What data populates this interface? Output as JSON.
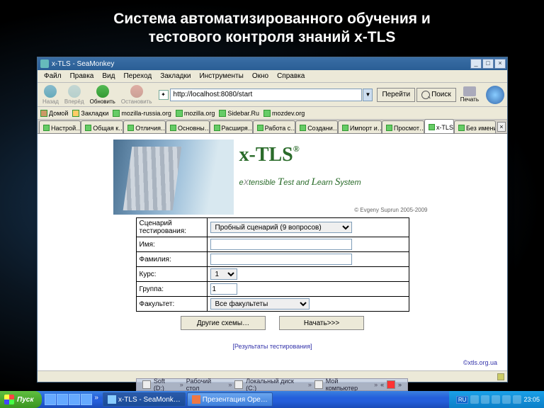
{
  "slide": {
    "title_l1": "Система автоматизированного обучения и",
    "title_l2": "тестового контроля знаний x-TLS"
  },
  "window": {
    "title": "x-TLS - SeaMonkey"
  },
  "menu": {
    "file": "Файл",
    "edit": "Правка",
    "view": "Вид",
    "go": "Переход",
    "bookmarks": "Закладки",
    "tools": "Инструменты",
    "window": "Окно",
    "help": "Справка"
  },
  "nav": {
    "back": "Назад",
    "forward": "Вперёд",
    "reload": "Обновить",
    "stop": "Остановить",
    "url": "http://localhost:8080/start",
    "go": "Перейти",
    "search": "Поиск",
    "print": "Печать"
  },
  "bookmarks": {
    "home": "Домой",
    "folder": "Закладки",
    "items": [
      "mozilla-russia.org",
      "mozilla.org",
      "Sidebar.Ru",
      "mozdev.org"
    ]
  },
  "tabs": {
    "items": [
      "Настрой…",
      "Общая к…",
      "Отличия…",
      "Основны…",
      "Расширя…",
      "Работа с…",
      "Создани…",
      "Импорт и…",
      "Просмот…",
      "x-TLS",
      "Без имени"
    ],
    "active_index": 9
  },
  "hero": {
    "logo": "x-TLS",
    "reg": "®",
    "tagline_pre": "e",
    "tagline_x": "X",
    "tagline_mid1": "tensible ",
    "tagline_t": "T",
    "tagline_mid2": "est and ",
    "tagline_l": "L",
    "tagline_mid3": "earn ",
    "tagline_s": "S",
    "tagline_end": "ystem",
    "copyright": "© Evgeny Suprun 2005-2009"
  },
  "form": {
    "scenario_label": "Сценарий тестирования:",
    "scenario_value": "Пробный сценарий (9 вопросов)",
    "name_label": "Имя:",
    "name_value": "",
    "surname_label": "Фамилия:",
    "surname_value": "",
    "course_label": "Курс:",
    "course_value": "1",
    "group_label": "Группа:",
    "group_value": "1",
    "faculty_label": "Факультет:",
    "faculty_value": "Все факультеты",
    "btn_other": "Другие схемы…",
    "btn_start": "Начать>>>"
  },
  "links": {
    "results": "[Результаты тестирования]",
    "site": "©xtls.org.ua"
  },
  "statusbar": {
    "left": "",
    "right": ""
  },
  "desktray": {
    "items": [
      "Soft (D:)",
      "Рабочий стол",
      "Локальный диск (C:)",
      "Мой компьютер"
    ]
  },
  "taskbar": {
    "start": "Пуск",
    "tasks": [
      "x-TLS - SeaMonk…",
      "Презентация Оре…"
    ],
    "lang": "RU",
    "clock": "23:05"
  }
}
